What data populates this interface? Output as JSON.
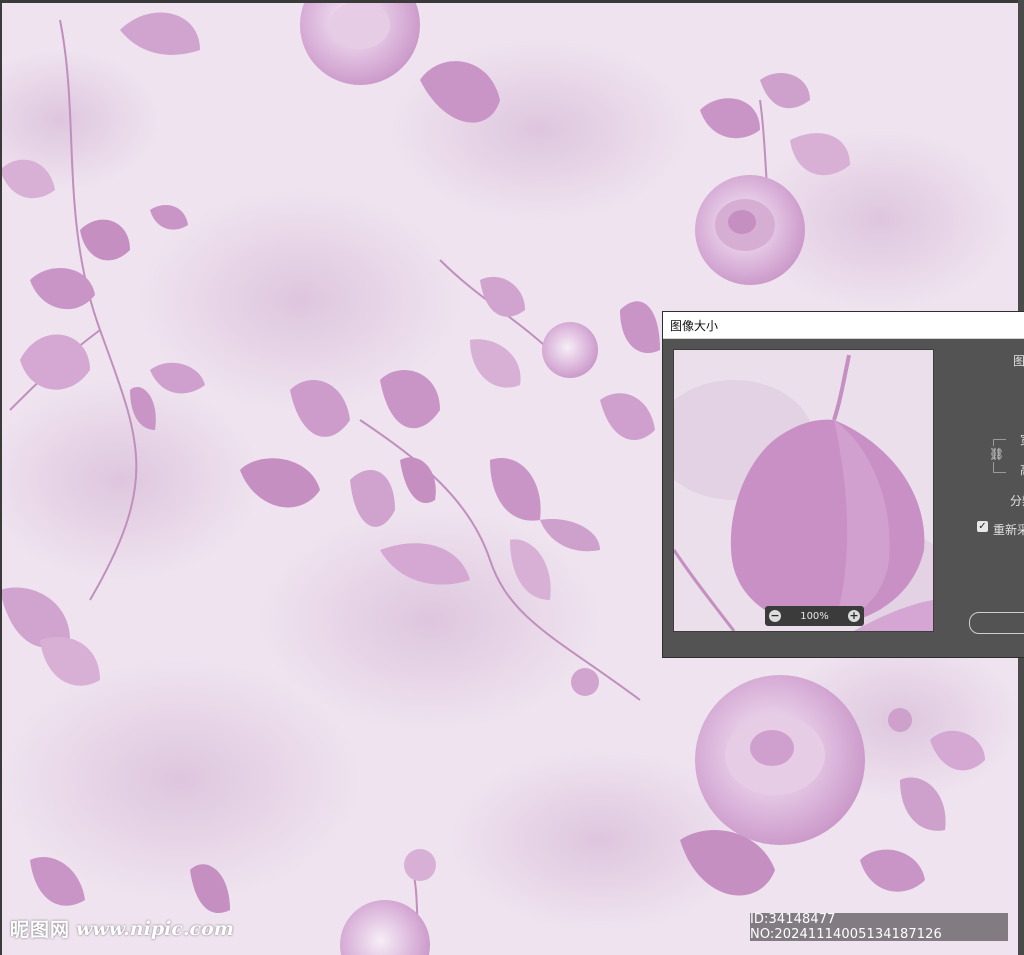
{
  "colors": {
    "canvas_bg": "#efe3ef",
    "petal": "#c995c6",
    "dialog_bg": "#535353"
  },
  "dialog": {
    "title": "图像大小",
    "zoom": {
      "minus_icon": "minus-circle-icon",
      "value": "100%",
      "plus_icon": "plus-circle-icon"
    },
    "labels": {
      "image_size": "图",
      "width": "宽",
      "height": "高",
      "resolution": "分辨",
      "resample": "重新采"
    },
    "resample_checked": true,
    "link_icon": "chain-link-icon"
  },
  "watermark": {
    "left_logo": "昵图网",
    "left_url": "www.nipic.com",
    "right_id": "ID:34148477 NO:20241114005134187126"
  }
}
